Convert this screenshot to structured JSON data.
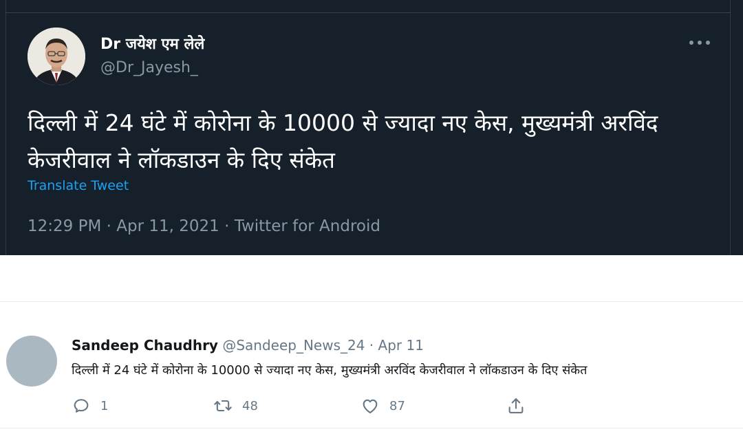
{
  "quoted_tweet": {
    "display_name": "Dr जयेश एम लेले",
    "handle": "@Dr_Jayesh_",
    "text": "दिल्ली में 24 घंटे में कोरोना के 10000 से ज्यादा नए केस, मुख्यमंत्री अरविंद केजरीवाल ने लॉकडाउन के दिए संकेत",
    "translate_label": "Translate Tweet",
    "time": "12:29 PM",
    "date": "Apr 11, 2021",
    "source": "Twitter for Android",
    "meta_separator": " · ",
    "more_icon": "more-horizontal-icon"
  },
  "reply_tweet": {
    "display_name": "Sandeep Chaudhry",
    "handle": "@Sandeep_News_24",
    "separator": " · ",
    "date": "Apr 11",
    "text": "दिल्ली में 24 घंटे में कोरोना के 10000 से ज्यादा नए केस, मुख्यमंत्री अरविंद केजरीवाल ने लॉकडाउन के दिए संकेत",
    "actions": {
      "reply": {
        "icon": "reply-icon",
        "count": "1"
      },
      "retweet": {
        "icon": "retweet-icon",
        "count": "48"
      },
      "like": {
        "icon": "heart-icon",
        "count": "87"
      },
      "share": {
        "icon": "share-icon"
      }
    }
  },
  "colors": {
    "dark_background": "#15202b",
    "link_blue": "#1da1f2",
    "muted_gray": "#8899a6",
    "avatar_placeholder": "#aab8c2"
  }
}
